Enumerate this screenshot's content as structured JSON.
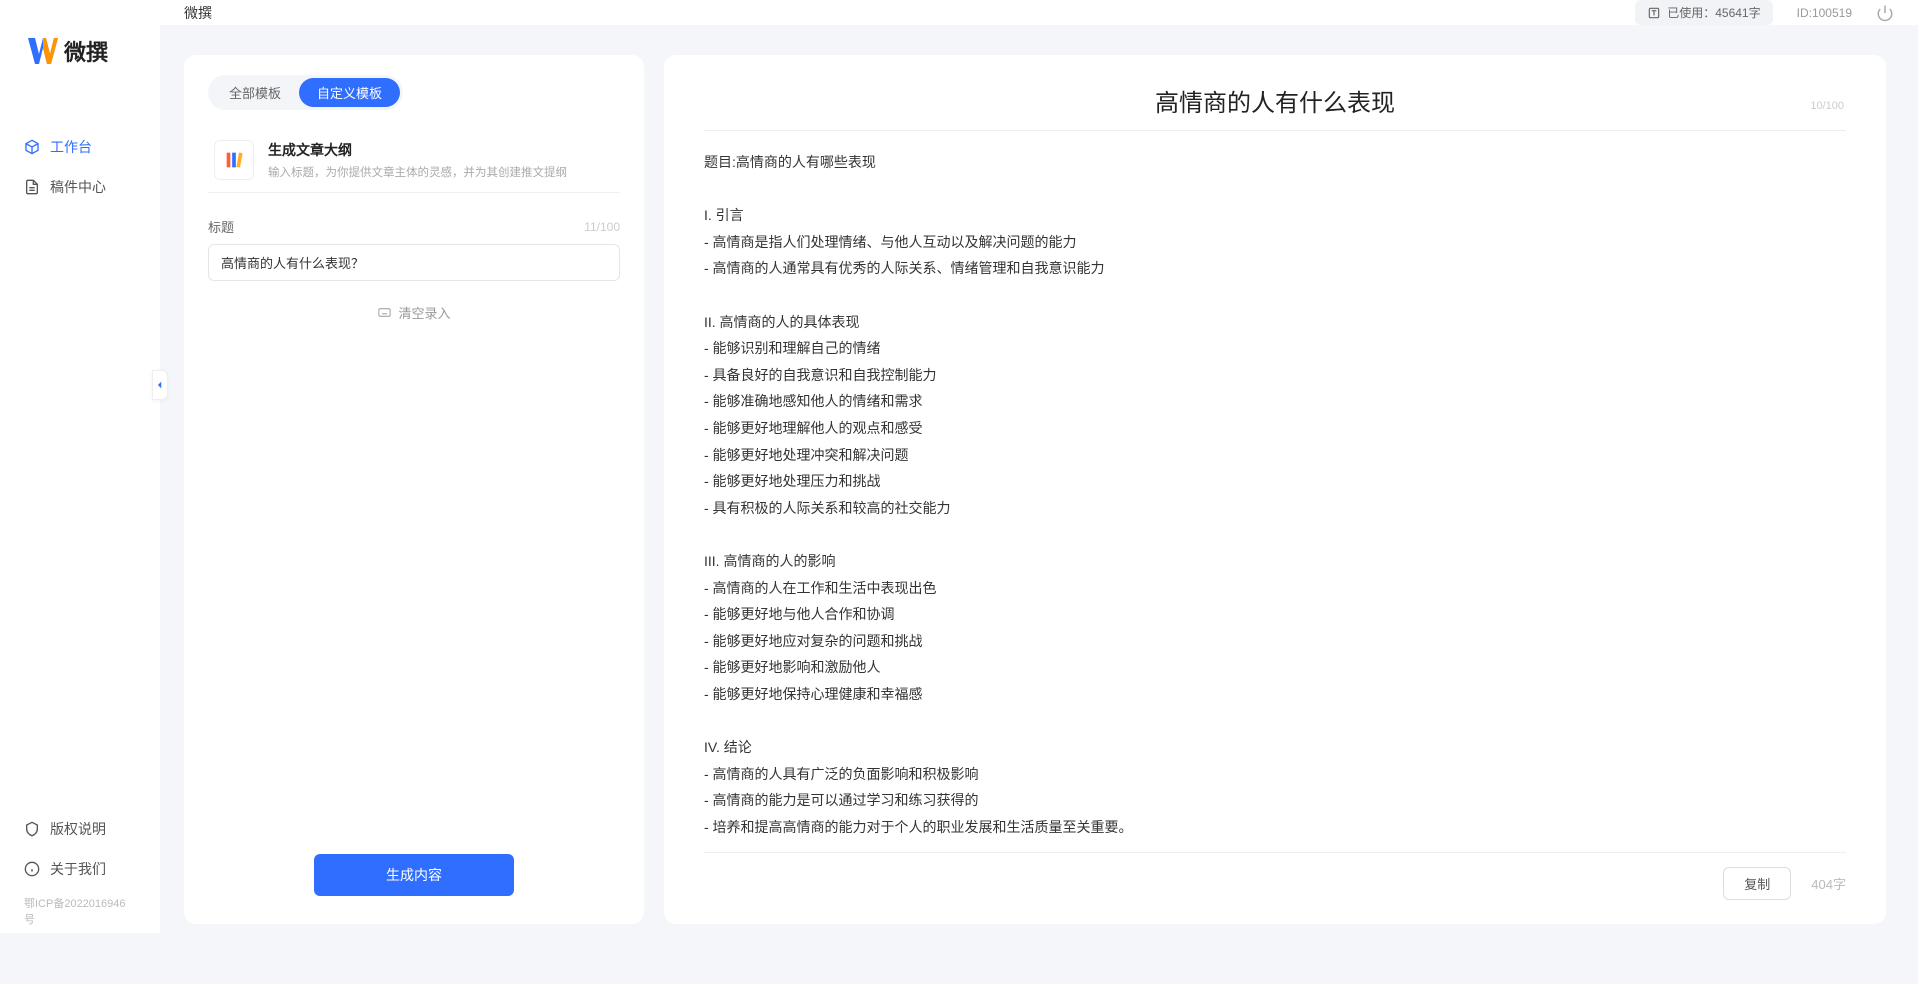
{
  "app_name": "微撰",
  "logo_text": "微撰",
  "sidebar": {
    "nav": [
      {
        "label": "工作台",
        "active": true
      },
      {
        "label": "稿件中心",
        "active": false
      }
    ],
    "bottom": [
      {
        "label": "版权说明"
      },
      {
        "label": "关于我们"
      }
    ],
    "footer_link": "鄂ICP备2022016946号"
  },
  "topbar": {
    "usage": "已使用：45641字",
    "id": "ID:100519"
  },
  "left_panel": {
    "tabs": [
      {
        "label": "全部模板",
        "active": false
      },
      {
        "label": "自定义模板",
        "active": true
      }
    ],
    "template": {
      "title": "生成文章大纲",
      "desc": "输入标题，为你提供文章主体的灵感，并为其创建推文提纲"
    },
    "field_label": "标题",
    "char_count": "11/100",
    "input_value": "高情商的人有什么表现？",
    "voice_label": "清空录入",
    "generate_label": "生成内容"
  },
  "right_panel": {
    "title": "高情商的人有什么表现",
    "title_count": "10/100",
    "body": "题目:高情商的人有哪些表现\n\nI. 引言\n- 高情商是指人们处理情绪、与他人互动以及解决问题的能力\n- 高情商的人通常具有优秀的人际关系、情绪管理和自我意识能力\n\nII. 高情商的人的具体表现\n- 能够识别和理解自己的情绪\n- 具备良好的自我意识和自我控制能力\n- 能够准确地感知他人的情绪和需求\n- 能够更好地理解他人的观点和感受\n- 能够更好地处理冲突和解决问题\n- 能够更好地处理压力和挑战\n- 具有积极的人际关系和较高的社交能力\n\nIII. 高情商的人的影响\n- 高情商的人在工作和生活中表现出色\n- 能够更好地与他人合作和协调\n- 能够更好地应对复杂的问题和挑战\n- 能够更好地影响和激励他人\n- 能够更好地保持心理健康和幸福感\n\nIV. 结论\n- 高情商的人具有广泛的负面影响和积极影响\n- 高情商的能力是可以通过学习和练习获得的\n- 培养和提高高情商的能力对于个人的职业发展和生活质量至关重要。",
    "copy_label": "复制",
    "word_count": "404字"
  }
}
